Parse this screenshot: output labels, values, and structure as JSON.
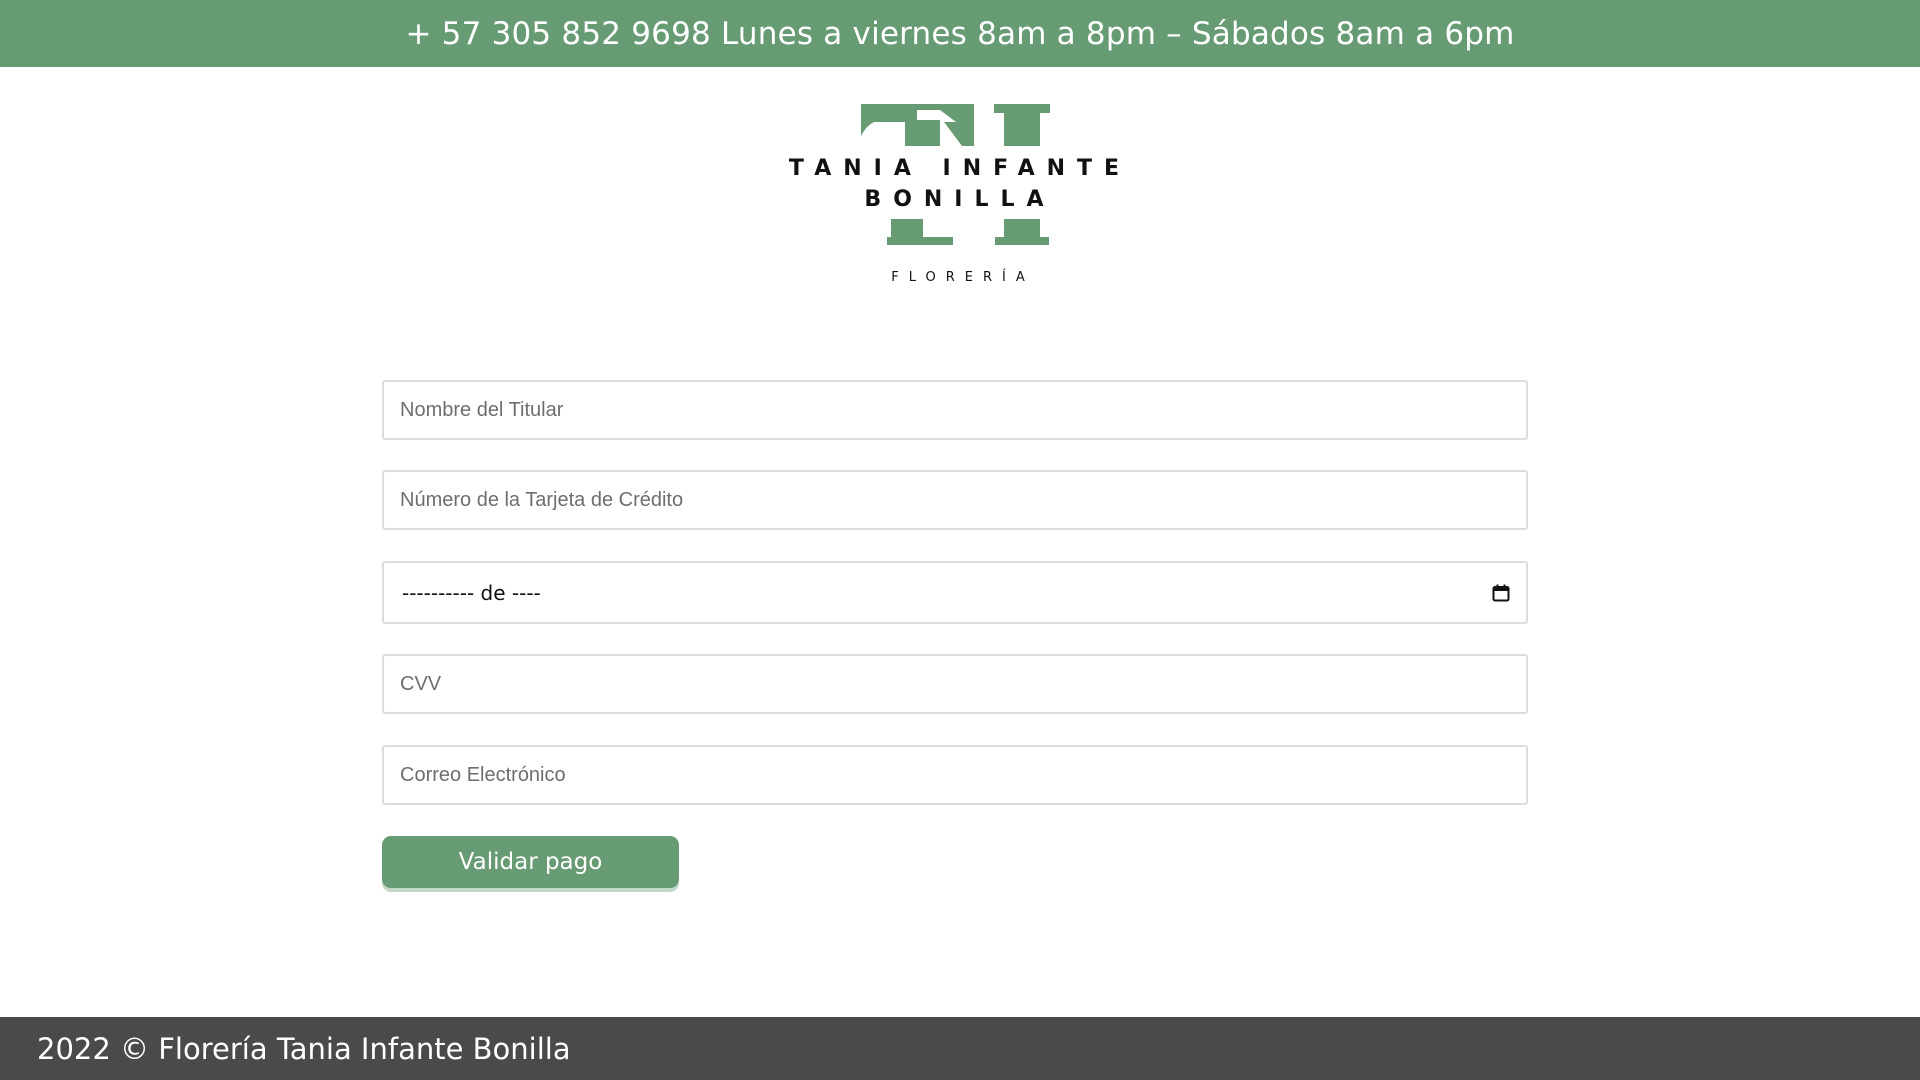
{
  "header": {
    "contact_text": "+ 57 305 852 9698 Lunes a viernes 8am a 8pm – Sábados 8am a 6pm",
    "background_color": "#679b73"
  },
  "logo": {
    "line1": "TANIA INFANTE",
    "line2": "BONILLA",
    "tagline": "FLORERÍA",
    "brand_color": "#679b73"
  },
  "form": {
    "holder_name": {
      "placeholder": "Nombre del Titular",
      "value": ""
    },
    "card_number": {
      "placeholder": "Número de la Tarjeta de Crédito",
      "value": ""
    },
    "expiry": {
      "display_value": "---------- de ----",
      "icon": "calendar-icon"
    },
    "cvv": {
      "placeholder": "CVV",
      "value": ""
    },
    "email": {
      "placeholder": "Correo Electrónico",
      "value": ""
    },
    "submit_label": "Validar pago"
  },
  "footer": {
    "text": "2022 © Florería Tania Infante Bonilla",
    "background_color": "#4a4a4a"
  }
}
